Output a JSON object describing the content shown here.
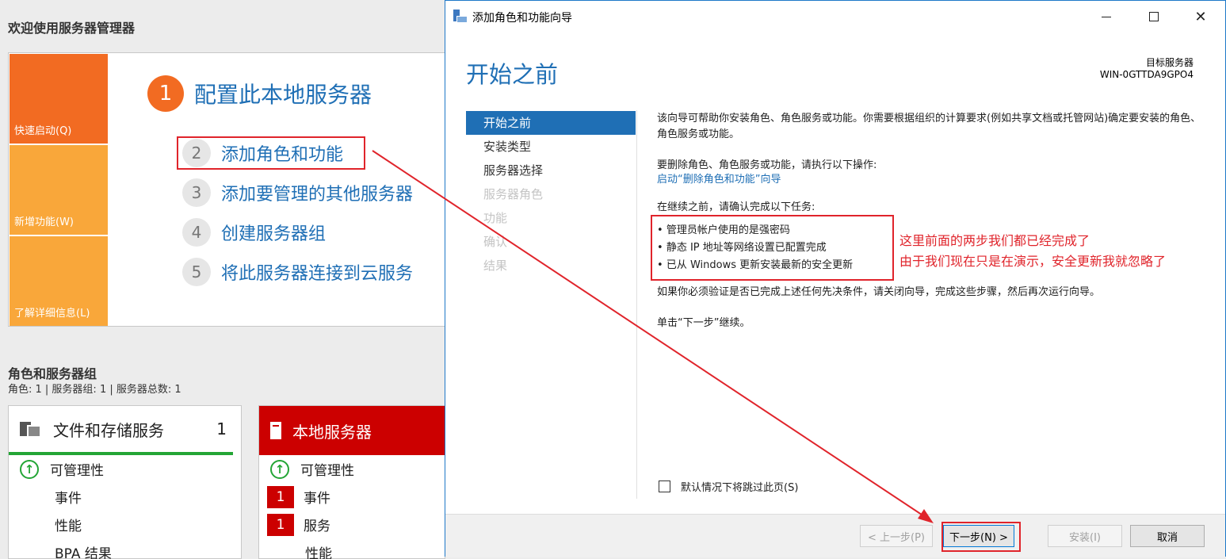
{
  "background": {
    "welcome_title": "欢迎使用服务器管理器",
    "tiles": {
      "quick_start": "快速启动(Q)",
      "whats_new": "新增功能(W)",
      "learn_more": "了解详细信息(L)"
    },
    "steps": [
      {
        "num": "1",
        "label": "配置此本地服务器"
      },
      {
        "num": "2",
        "label": "添加角色和功能"
      },
      {
        "num": "3",
        "label": "添加要管理的其他服务器"
      },
      {
        "num": "4",
        "label": "创建服务器组"
      },
      {
        "num": "5",
        "label": "将此服务器连接到云服务"
      }
    ],
    "roles_title": "角色和服务器组",
    "roles_subtitle": "角色: 1 | 服务器组: 1 | 服务器总数: 1",
    "file_storage_card": {
      "title": "文件和存储服务",
      "count": "1",
      "rows": [
        "可管理性",
        "事件",
        "性能",
        "BPA 结果"
      ]
    },
    "local_server_card": {
      "title": "本地服务器",
      "rows": [
        {
          "badge": "",
          "label": "可管理性"
        },
        {
          "badge": "1",
          "label": "事件"
        },
        {
          "badge": "1",
          "label": "服务"
        },
        {
          "badge": "",
          "label": "性能"
        }
      ]
    }
  },
  "wizard": {
    "window_title": "添加角色和功能向导",
    "heading": "开始之前",
    "target_label": "目标服务器",
    "target_value": "WIN-0GTTDA9GPO4",
    "nav": [
      {
        "label": "开始之前",
        "state": "active"
      },
      {
        "label": "安装类型",
        "state": "normal"
      },
      {
        "label": "服务器选择",
        "state": "normal"
      },
      {
        "label": "服务器角色",
        "state": "disabled"
      },
      {
        "label": "功能",
        "state": "disabled"
      },
      {
        "label": "确认",
        "state": "disabled"
      },
      {
        "label": "结果",
        "state": "disabled"
      }
    ],
    "para1": "该向导可帮助你安装角色、角色服务或功能。你需要根据组织的计算要求(例如共享文档或托管网站)确定要安装的角色、角色服务或功能。",
    "para2": "要删除角色、角色服务或功能，请执行以下操作:",
    "link": "启动“删除角色和功能”向导",
    "para3": "在继续之前，请确认完成以下任务:",
    "bullets": [
      "管理员帐户使用的是强密码",
      "静态 IP 地址等网络设置已配置完成",
      "已从 Windows 更新安装最新的安全更新"
    ],
    "para4": "如果你必须验证是否已完成上述任何先决条件，请关闭向导，完成这些步骤，然后再次运行向导。",
    "para5": "单击“下一步”继续。",
    "skip_checkbox": "默认情况下将跳过此页(S)",
    "buttons": {
      "prev": "< 上一步(P)",
      "next": "下一步(N) >",
      "install": "安装(I)",
      "cancel": "取消"
    }
  },
  "annotations": {
    "line1": "这里前面的两步我们都已经完成了",
    "line2": "由于我们现在只是在演示，安全更新我就忽略了"
  },
  "colors": {
    "accent_blue": "#1f6fb5",
    "orange": "#f26b22",
    "light_orange": "#f9a73a",
    "annotation_red": "#e0242b",
    "server_red": "#cc0000",
    "ok_green": "#23a535"
  }
}
